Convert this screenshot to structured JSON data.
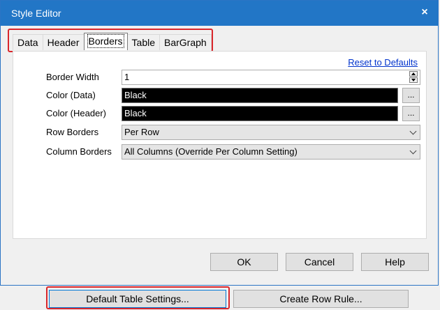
{
  "window": {
    "title": "Style Editor",
    "close_glyph": "×"
  },
  "tabs": [
    {
      "label": "Data",
      "active": false
    },
    {
      "label": "Header",
      "active": false
    },
    {
      "label": "Borders",
      "active": true
    },
    {
      "label": "Table",
      "active": false
    },
    {
      "label": "BarGraph",
      "active": false
    }
  ],
  "panel": {
    "reset_link": "Reset to Defaults",
    "border_width": {
      "label": "Border Width",
      "value": "1"
    },
    "color_data": {
      "label": "Color (Data)",
      "value": "Black",
      "button": "..."
    },
    "color_header": {
      "label": "Color (Header)",
      "value": "Black",
      "button": "..."
    },
    "row_borders": {
      "label": "Row Borders",
      "value": "Per Row"
    },
    "column_borders": {
      "label": "Column Borders",
      "value": "All Columns (Override Per Column Setting)"
    }
  },
  "buttons": {
    "ok": "OK",
    "cancel": "Cancel",
    "help": "Help"
  },
  "bottom": {
    "default_table": "Default Table Settings...",
    "create_row_rule": "Create Row Rule..."
  },
  "colors": {
    "titlebar": "#2276c6",
    "highlight": "#d9262b",
    "link": "#0033cc"
  }
}
